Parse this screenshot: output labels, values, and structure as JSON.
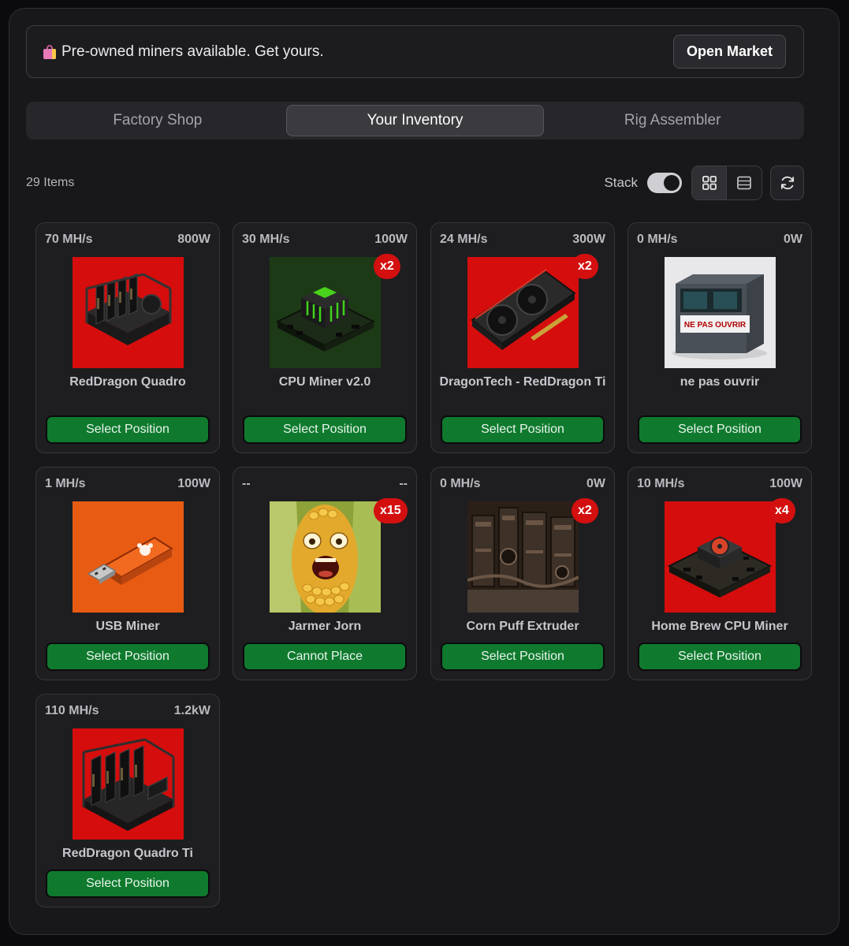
{
  "banner": {
    "text": "Pre-owned miners available. Get yours.",
    "button": "Open Market"
  },
  "tabs": [
    {
      "label": "Factory Shop",
      "active": false
    },
    {
      "label": "Your Inventory",
      "active": true
    },
    {
      "label": "Rig Assembler",
      "active": false
    }
  ],
  "toolbar": {
    "count": "29 Items",
    "stack_label": "Stack",
    "stack_on": true,
    "view": "grid"
  },
  "colors": {
    "action_green": "#0f7a2e",
    "badge_red": "#d40f0f",
    "panel_bg": "#18181b"
  },
  "items": [
    {
      "hashrate": "70 MH/s",
      "power": "800W",
      "name": "RedDragon Quadro",
      "qty": "",
      "action": "Select Position",
      "image": "rig-4gpu-red"
    },
    {
      "hashrate": "30 MH/s",
      "power": "100W",
      "name": "CPU Miner v2.0",
      "qty": "x2",
      "action": "Select Position",
      "image": "cpu-board-green"
    },
    {
      "hashrate": "24 MH/s",
      "power": "300W",
      "name": "DragonTech - RedDragon Ti",
      "qty": "x2",
      "action": "Select Position",
      "image": "gpu-card-red"
    },
    {
      "hashrate": "0 MH/s",
      "power": "0W",
      "name": "ne pas ouvrir",
      "qty": "",
      "action": "Select Position",
      "image": "box-label"
    },
    {
      "hashrate": "1 MH/s",
      "power": "100W",
      "name": "USB Miner",
      "qty": "",
      "action": "Select Position",
      "image": "usb-orange"
    },
    {
      "hashrate": "--",
      "power": "--",
      "name": "Jarmer Jorn",
      "qty": "x15",
      "action": "Cannot Place",
      "image": "corn-face"
    },
    {
      "hashrate": "0 MH/s",
      "power": "0W",
      "name": "Corn Puff Extruder",
      "qty": "x2",
      "action": "Select Position",
      "image": "machinery-brown"
    },
    {
      "hashrate": "10 MH/s",
      "power": "100W",
      "name": "Home Brew CPU Miner",
      "qty": "x4",
      "action": "Select Position",
      "image": "cpu-board-red"
    },
    {
      "hashrate": "110 MH/s",
      "power": "1.2kW",
      "name": "RedDragon Quadro Ti",
      "qty": "",
      "action": "Select Position",
      "image": "rig-4gpu-red"
    }
  ],
  "box_label_text": "NE PAS OUVRIR"
}
